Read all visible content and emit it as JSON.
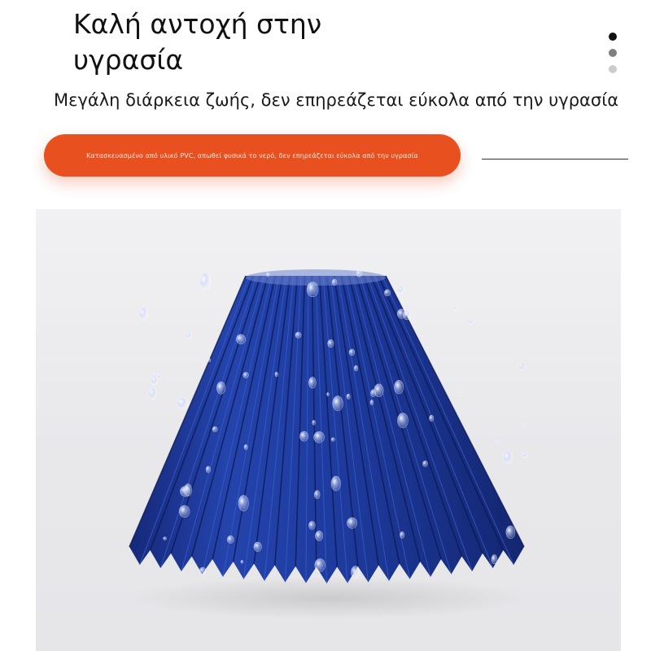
{
  "header": {
    "title_line1": "Καλή αντοχή στην",
    "title_line2": "υγρασία",
    "subtitle": "Μεγάλη διάρκεια ζωής, δεν επηρεάζεται εύκολα από την υγρασία"
  },
  "pagination": {
    "total": 3,
    "active_index": 0,
    "colors": [
      "#111111",
      "#808080",
      "#cccccc"
    ]
  },
  "feature_pill": {
    "text": "Κατασκευασμένο από υλικό PVC, απωθεί φυσικά το νερό, δεν επηρεάζεται εύκολα από την υγρασία",
    "color": "#e8501f"
  },
  "product_image": {
    "subject": "pleated-lampshade",
    "shade_color": "#1f3a98",
    "background_color": "#ececef"
  }
}
